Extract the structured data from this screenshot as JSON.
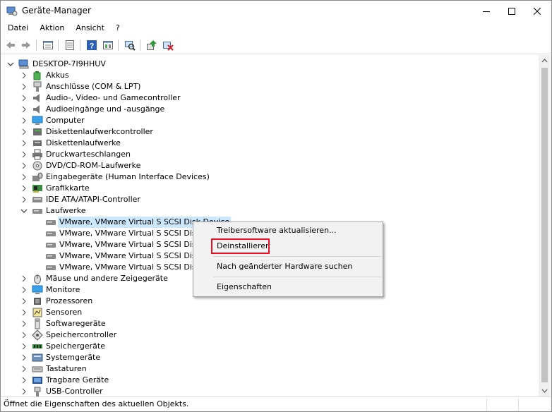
{
  "window": {
    "title": "Geräte-Manager",
    "icon": "device-manager-icon"
  },
  "menu": {
    "items": [
      "Datei",
      "Aktion",
      "Ansicht",
      "?"
    ]
  },
  "toolbar": {
    "buttons": [
      "back-arrow-icon",
      "forward-arrow-icon",
      "properties-icon",
      "list-view-icon",
      "help-icon",
      "resources-icon",
      "scan-hardware-icon",
      "update-driver-icon",
      "uninstall-device-icon"
    ]
  },
  "tree": {
    "root": "DESKTOP-7I9HHUV",
    "categories": [
      {
        "label": "Akkus",
        "icon": "battery-icon"
      },
      {
        "label": "Anschlüsse (COM & LPT)",
        "icon": "port-icon"
      },
      {
        "label": "Audio-, Video- und Gamecontroller",
        "icon": "speaker-icon"
      },
      {
        "label": "Audioeingänge und -ausgänge",
        "icon": "speaker-icon"
      },
      {
        "label": "Computer",
        "icon": "monitor-icon"
      },
      {
        "label": "Diskettenlaufwerkcontroller",
        "icon": "controller-icon"
      },
      {
        "label": "Diskettenlaufwerke",
        "icon": "floppy-icon"
      },
      {
        "label": "Druckwarteschlangen",
        "icon": "printer-icon"
      },
      {
        "label": "DVD/CD-ROM-Laufwerke",
        "icon": "dvd-icon"
      },
      {
        "label": "Eingabegeräte (Human Interface Devices)",
        "icon": "hid-icon"
      },
      {
        "label": "Grafikkarte",
        "icon": "display-adapter-icon"
      },
      {
        "label": "IDE ATA/ATAPI-Controller",
        "icon": "ide-icon"
      }
    ],
    "expanded": {
      "label": "Laufwerke",
      "children": [
        "VMware, VMware Virtual S SCSI Disk Device",
        "VMware, VMware Virtual S SCSI Disk",
        "VMware, VMware Virtual S SCSI Disk",
        "VMware, VMware Virtual S SCSI Disk",
        "VMware, VMware Virtual S SCSI Disk"
      ]
    },
    "categories_after": [
      {
        "label": "Mäuse und andere Zeigegeräte",
        "icon": "mouse-icon"
      },
      {
        "label": "Monitore",
        "icon": "monitor-icon"
      },
      {
        "label": "Prozessoren",
        "icon": "cpu-icon"
      },
      {
        "label": "Sensoren",
        "icon": "sensor-icon"
      },
      {
        "label": "Softwaregeräte",
        "icon": "software-device-icon"
      },
      {
        "label": "Speichercontroller",
        "icon": "storage-controller-icon"
      },
      {
        "label": "Speichergeräte",
        "icon": "memory-icon"
      },
      {
        "label": "Systemgeräte",
        "icon": "system-icon"
      },
      {
        "label": "Tastaturen",
        "icon": "keyboard-icon"
      },
      {
        "label": "Tragbare Geräte",
        "icon": "portable-device-icon"
      },
      {
        "label": "USB-Controller",
        "icon": "usb-icon"
      }
    ]
  },
  "context_menu": {
    "items": [
      "Treibersoftware aktualisieren...",
      "Deinstallieren",
      "Nach geänderter Hardware suchen",
      "Eigenschaften"
    ],
    "highlighted": "Deinstallieren",
    "highlight_color": "#e81123"
  },
  "status": {
    "text": "Öffnet die Eigenschaften des aktuellen Objekts."
  },
  "colors": {
    "selection": "#cce8ff",
    "menu_bg": "#f2f2f2"
  }
}
